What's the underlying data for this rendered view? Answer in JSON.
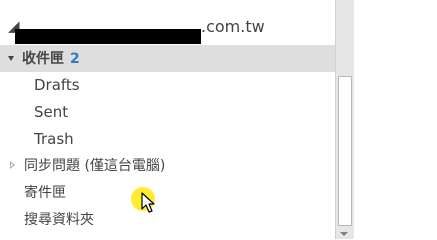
{
  "account": {
    "domain_suffix": ".com.tw"
  },
  "folders": {
    "inbox": {
      "label": "收件匣",
      "unread_count": "2"
    },
    "drafts": {
      "label": "Drafts"
    },
    "sent": {
      "label": "Sent"
    },
    "trash": {
      "label": "Trash"
    },
    "sync_issues": {
      "label": "同步問題 (僅這台電腦)"
    },
    "outbox": {
      "label": "寄件匣"
    },
    "search_folders": {
      "label": "搜尋資料夾"
    }
  },
  "colors": {
    "selection": "#dedede",
    "unread_count": "#2f7ac4",
    "text": "#444444",
    "cursor_highlight": "#ffe800"
  },
  "icons": {
    "expanded": "triangle-down-icon",
    "collapsed": "triangle-right-icon",
    "cursor": "mouse-pointer-icon"
  }
}
